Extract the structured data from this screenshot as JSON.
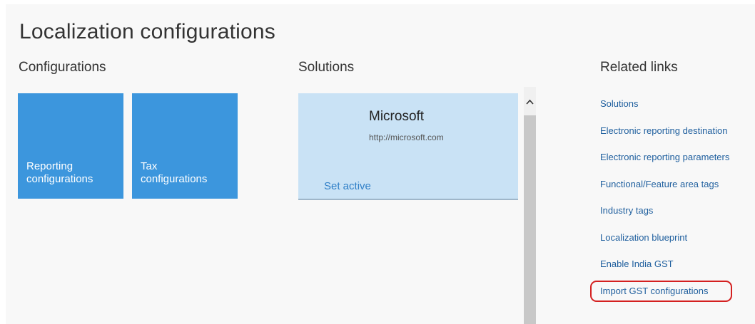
{
  "page": {
    "title": "Localization configurations",
    "background": "#f8f8f8"
  },
  "configurations": {
    "heading": "Configurations",
    "tiles": [
      {
        "label": "Reporting\nconfigurations"
      },
      {
        "label": "Tax\nconfigurations"
      }
    ],
    "tile_color": "#3c96dd"
  },
  "solutions": {
    "heading": "Solutions",
    "card": {
      "name": "Microsoft",
      "url": "http://microsoft.com",
      "action": "Set active"
    },
    "card_color": "#c9e2f5",
    "scroll_up_icon": "chevron-up-icon"
  },
  "related_links": {
    "heading": "Related links",
    "items": [
      "Solutions",
      "Electronic reporting destination",
      "Electronic reporting parameters",
      "Functional/Feature area tags",
      "Industry tags",
      "Localization blueprint",
      "Enable India GST",
      "Import GST configurations"
    ],
    "link_color": "#1f5f9e",
    "highlighted_item": "Import GST configurations",
    "highlight_color": "#d42020"
  }
}
